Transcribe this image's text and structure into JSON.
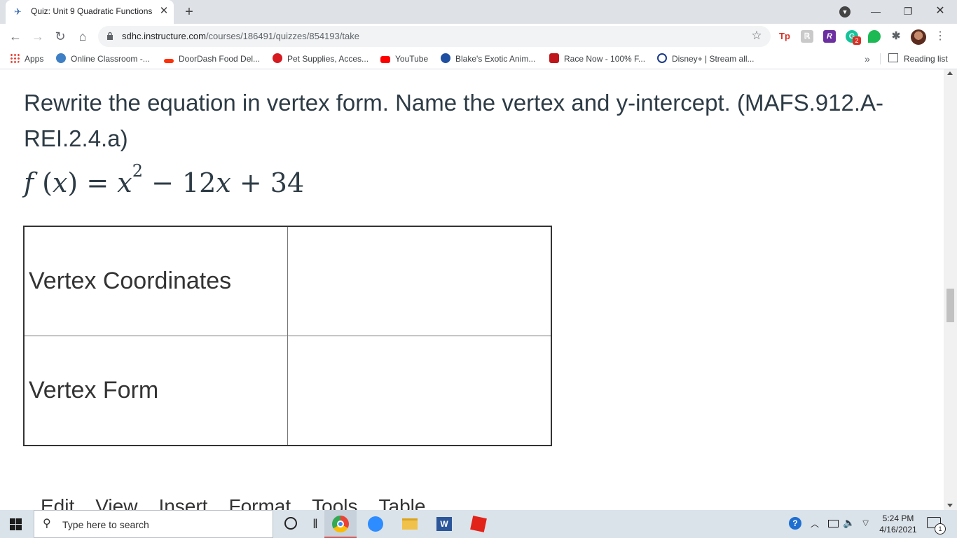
{
  "browser": {
    "tab": {
      "title": "Quiz: Unit 9 Quadratic Functions"
    },
    "url": {
      "host": "sdhc.instructure.com",
      "path": "/courses/186491/quizzes/854193/take"
    },
    "extension_badge": "2",
    "bookmarks": [
      {
        "label": "Apps"
      },
      {
        "label": "Online Classroom -..."
      },
      {
        "label": "DoorDash Food Del..."
      },
      {
        "label": "Pet Supplies, Acces..."
      },
      {
        "label": "YouTube"
      },
      {
        "label": "Blake's Exotic Anim..."
      },
      {
        "label": "Race Now - 100% F..."
      },
      {
        "label": "Disney+ | Stream all..."
      }
    ],
    "bookmarks_more": "»",
    "reading_list": "Reading list"
  },
  "page": {
    "question": "Rewrite the equation in vertex form. Name the vertex and y-intercept. (MAFS.912.A-REI.2.4.a)",
    "equation": {
      "fn": "f",
      "var": "x",
      "exponent": "2",
      "rest_op": "− 12",
      "rest_const": "+ 34"
    },
    "table": {
      "rows": [
        {
          "label": "Vertex Coordinates",
          "answer": ""
        },
        {
          "label": "Vertex Form",
          "answer": ""
        }
      ]
    },
    "editor_menu": [
      "Edit",
      "View",
      "Insert",
      "Format",
      "Tools",
      "Table"
    ]
  },
  "taskbar": {
    "search_placeholder": "Type here to search",
    "time": "5:24 PM",
    "date": "4/16/2021",
    "notification_count": "1"
  }
}
